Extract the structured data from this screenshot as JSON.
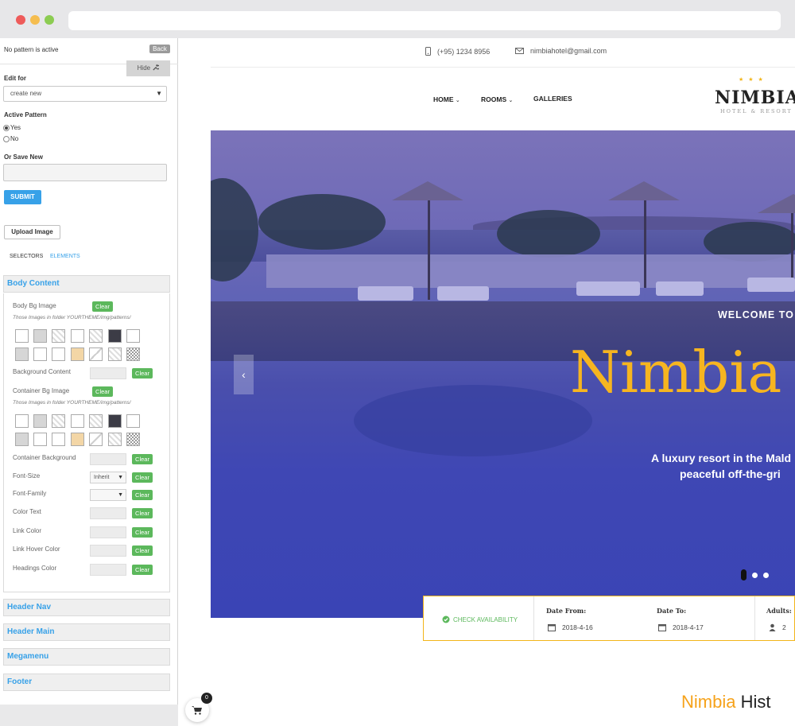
{
  "panel": {
    "status": "No pattern is active",
    "back_label": "Back",
    "hide_label": "Hide",
    "edit_for_label": "Edit for",
    "edit_for_value": "create new",
    "active_pattern_label": "Active Pattern",
    "radio_yes": "Yes",
    "radio_no": "No",
    "or_save_new_label": "Or Save New",
    "save_new_value": "",
    "submit_label": "SUBMIT",
    "upload_label": "Upload Image",
    "tab_selectors": "SELECTORS",
    "tab_elements": "ELEMENTS",
    "clear_label": "Clear",
    "sections": {
      "body_content": "Body Content",
      "header_nav": "Header Nav",
      "header_main": "Header Main",
      "megamenu": "Megamenu",
      "footer": "Footer"
    },
    "fields": {
      "body_bg_image": "Body Bg Image",
      "images_note": "Those Images in folder YOURTHEME/img/patterns/",
      "background_content": "Background Content",
      "container_bg_image": "Container Bg Image",
      "container_background": "Container Background",
      "font_size": "Font-Size",
      "font_size_value": "Inherit",
      "font_family": "Font-Family",
      "color_text": "Color Text",
      "link_color": "Link Color",
      "link_hover_color": "Link Hover Color",
      "headings_color": "Headings Color"
    }
  },
  "site": {
    "phone": "(+95) 1234 8956",
    "email": "nimbiahotel@gmail.com",
    "nav": [
      "HOME",
      "ROOMS",
      "GALLERIES"
    ],
    "logo": "NIMBIA",
    "logo_sub": "HOTEL & RESORT",
    "hero": {
      "welcome": "WELCOME TO",
      "title": "Nimbia",
      "sub1": "A luxury resort in the Mald",
      "sub2": "peaceful off-the-gri"
    },
    "booking": {
      "check": "CHECK AVAILABILITY",
      "date_from_label": "Date From:",
      "date_from": "2018-4-16",
      "date_to_label": "Date To:",
      "date_to": "2018-4-17",
      "adults_label": "Adults:",
      "adults": "2"
    },
    "history_highlight": "Nimbia",
    "history_rest": "Hist",
    "cart_count": "0"
  },
  "colors": {
    "accent_blue": "#37a1e8",
    "clear_green": "#5cb85c",
    "gold": "#f6b520"
  }
}
